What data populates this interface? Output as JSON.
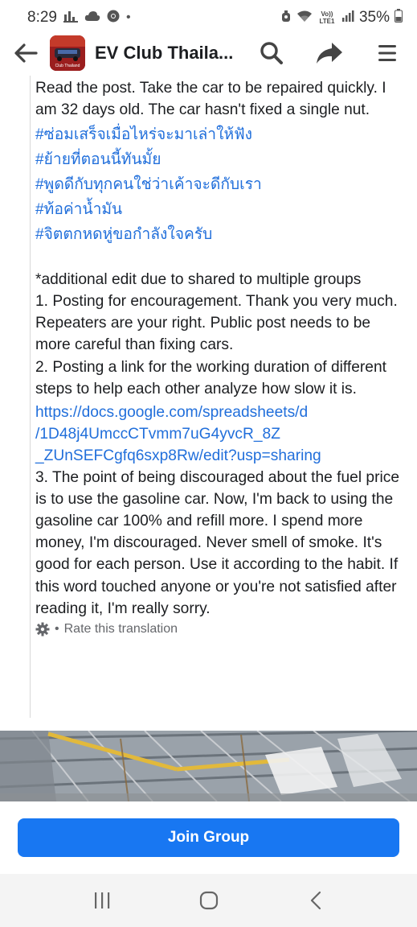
{
  "status_bar": {
    "time": "8:29",
    "dot": "•",
    "battery": "35%",
    "volte": "Vo)) LTE1"
  },
  "header": {
    "title": "EV Club Thaila...",
    "thumb_label": "Club Thailand"
  },
  "post": {
    "paragraph1": "Read the post. Take the car to be repaired quickly. I am 32 days old. The car hasn't fixed a single nut.",
    "hashtags": [
      "#ซ่อมเสร็จเมื่อไหร่จะมาเล่าให้ฟัง",
      "#ย้ายที่ตอนนี้ทันมั้ย",
      "#พูดดีกับทุกคนใช่ว่าเค้าจะดีกับเรา",
      "#ท้อค่าน้ำมัน",
      "#จิตตกหดหู่ขอกำลังใจครับ"
    ],
    "edit_note": "*additional edit due to shared to multiple groups",
    "point1": "1. Posting for encouragement. Thank you very much. Repeaters are your right. Public post needs to be more careful than fixing cars.",
    "point2": "2. Posting a link for the working duration of different steps to help each other analyze how slow it is.",
    "link_lines": [
      "https://docs.google.com/spreadsheets/d",
      "/1D48j4UmccCTvmm7uG4yvcR_8Z",
      "_ZUnSEFCgfq6sxp8Rw/edit?usp=sharing"
    ],
    "point3": "3. The point of being discouraged about the fuel price is to use the gasoline car. Now, I'm back to using the gasoline car 100% and refill more. I spend more money, I'm discouraged. Never smell of smoke. It's good for each person. Use it according to the habit. If this word touched anyone or you're not satisfied after reading it, I'm really sorry.",
    "rate_prefix": "•",
    "rate_translation": "Rate this translation"
  },
  "join_button": {
    "label": "Join Group"
  },
  "colors": {
    "accent": "#1877f2",
    "link": "#216fdb",
    "text": "#1c1e21",
    "muted": "#65676b"
  }
}
